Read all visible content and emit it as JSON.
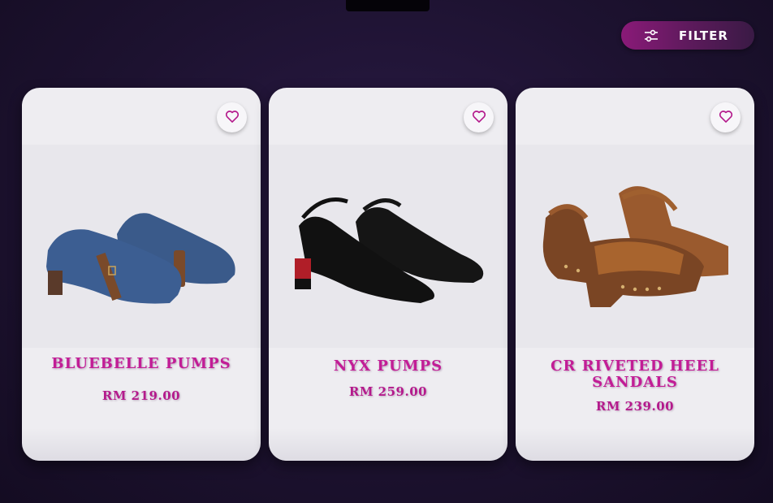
{
  "filter": {
    "label": "FILTER"
  },
  "products": [
    {
      "name": "BLUEBELLE PUMPS",
      "price": "RM 219.00"
    },
    {
      "name": "NYX PUMPS",
      "price": "RM 259.00"
    },
    {
      "name": "CR RIVETED HEEL SANDALS",
      "price": "RM 239.00"
    }
  ]
}
